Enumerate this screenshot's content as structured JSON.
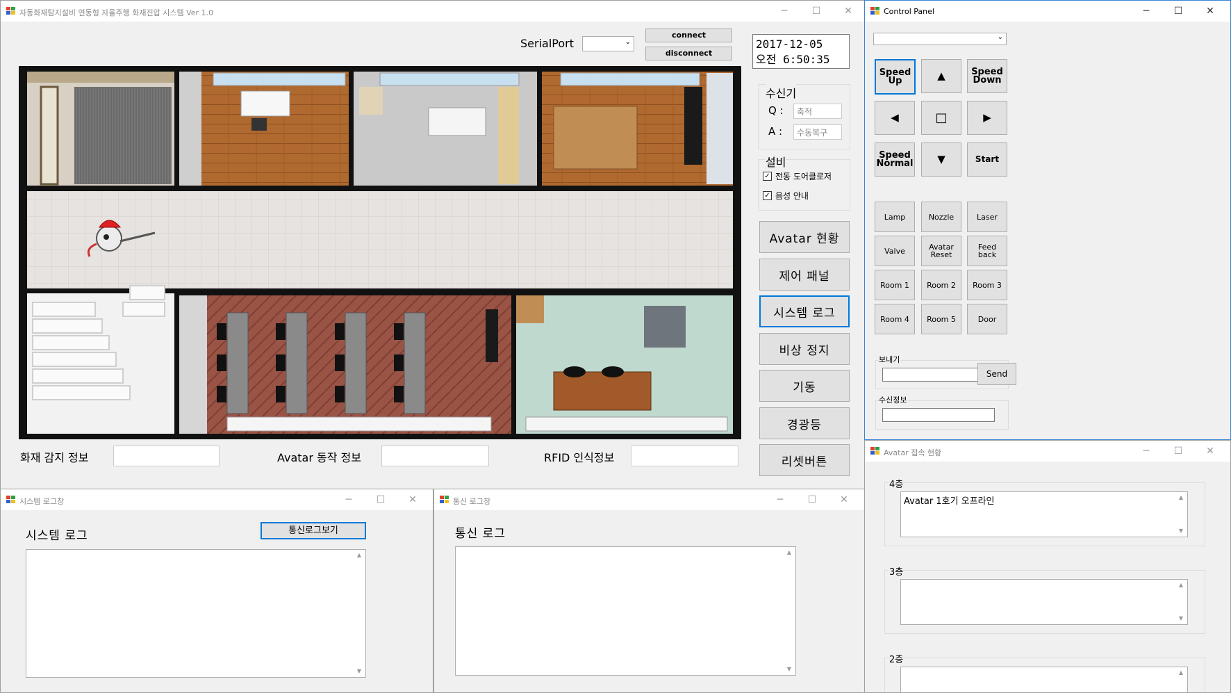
{
  "main_window": {
    "title": "자동화재탐지설비 연동형 자율주행 화재진압 시스템 Ver 1.0",
    "serialport_label": "SerialPort",
    "serialport_value": "",
    "connect_label": "connect",
    "disconnect_label": "disconnect",
    "date": "2017-12-05",
    "time": "오전 6:50:35",
    "receiver": {
      "title": "수신기",
      "q_label": "Q :",
      "q_value": "축적",
      "a_label": "A :",
      "a_value": "수동복구"
    },
    "equipment": {
      "title": "설비",
      "door_closer": "전동 도어클로저",
      "voice_guide": "음성 안내"
    },
    "side_buttons": [
      "Avatar 현황",
      "제어 패널",
      "시스템 로그",
      "비상 정지",
      "기동",
      "경광등",
      "리셋버튼"
    ],
    "fire_info_label": "화재 감지 정보",
    "avatar_info_label": "Avatar 동작 정보",
    "rfid_info_label": "RFID 인식정보"
  },
  "control_panel": {
    "title": "Control Panel",
    "speed_up": "Speed Up",
    "speed_down": "Speed Down",
    "speed_normal": "Speed Normal",
    "start": "Start",
    "up_arrow": "▲",
    "down_arrow": "▼",
    "left_arrow": "◀",
    "right_arrow": "▶",
    "stop": "□",
    "functions": [
      "Lamp",
      "Nozzle",
      "Laser",
      "Valve",
      "Avatar Reset",
      "Feed back",
      "Room 1",
      "Room 2",
      "Room 3",
      "Room 4",
      "Room 5",
      "Door"
    ],
    "send_group": "보내기",
    "send_button": "Send",
    "recv_group": "수신정보"
  },
  "system_log": {
    "title": "시스템 로그창",
    "heading": "시스템 로그",
    "view_comm_button": "통신로그보기"
  },
  "comm_log": {
    "title": "통신 로그창",
    "heading": "통신 로그"
  },
  "avatar_status": {
    "title": "Avatar 접속 현황",
    "floor4": "4층",
    "floor4_text": "Avatar 1호기 오프라인",
    "floor3": "3층",
    "floor3_text": "",
    "floor2": "2층",
    "floor2_text": ""
  },
  "colors": {
    "accent": "#0078d7",
    "floor_black": "#111111",
    "wood": "#b0692f",
    "brick": "#9a5446"
  }
}
